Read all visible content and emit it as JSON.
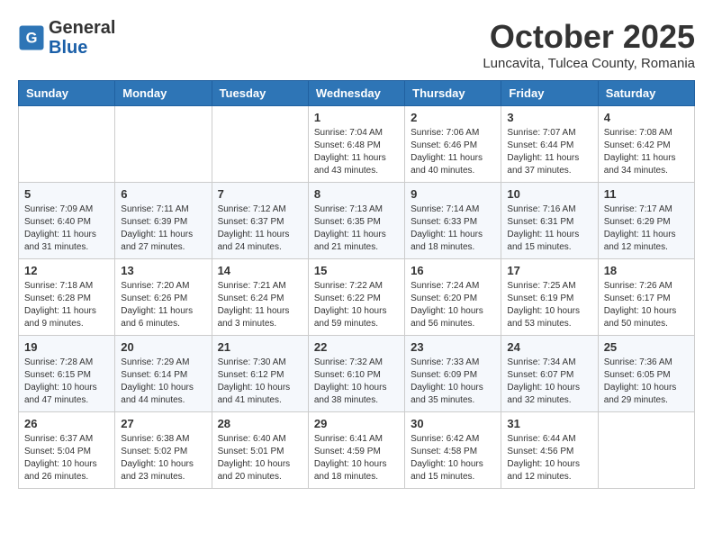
{
  "header": {
    "logo": {
      "general": "General",
      "blue": "Blue"
    },
    "title": "October 2025",
    "subtitle": "Luncavita, Tulcea County, Romania"
  },
  "weekdays": [
    "Sunday",
    "Monday",
    "Tuesday",
    "Wednesday",
    "Thursday",
    "Friday",
    "Saturday"
  ],
  "weeks": [
    [
      {
        "day": "",
        "info": ""
      },
      {
        "day": "",
        "info": ""
      },
      {
        "day": "",
        "info": ""
      },
      {
        "day": "1",
        "info": "Sunrise: 7:04 AM\nSunset: 6:48 PM\nDaylight: 11 hours\nand 43 minutes."
      },
      {
        "day": "2",
        "info": "Sunrise: 7:06 AM\nSunset: 6:46 PM\nDaylight: 11 hours\nand 40 minutes."
      },
      {
        "day": "3",
        "info": "Sunrise: 7:07 AM\nSunset: 6:44 PM\nDaylight: 11 hours\nand 37 minutes."
      },
      {
        "day": "4",
        "info": "Sunrise: 7:08 AM\nSunset: 6:42 PM\nDaylight: 11 hours\nand 34 minutes."
      }
    ],
    [
      {
        "day": "5",
        "info": "Sunrise: 7:09 AM\nSunset: 6:40 PM\nDaylight: 11 hours\nand 31 minutes."
      },
      {
        "day": "6",
        "info": "Sunrise: 7:11 AM\nSunset: 6:39 PM\nDaylight: 11 hours\nand 27 minutes."
      },
      {
        "day": "7",
        "info": "Sunrise: 7:12 AM\nSunset: 6:37 PM\nDaylight: 11 hours\nand 24 minutes."
      },
      {
        "day": "8",
        "info": "Sunrise: 7:13 AM\nSunset: 6:35 PM\nDaylight: 11 hours\nand 21 minutes."
      },
      {
        "day": "9",
        "info": "Sunrise: 7:14 AM\nSunset: 6:33 PM\nDaylight: 11 hours\nand 18 minutes."
      },
      {
        "day": "10",
        "info": "Sunrise: 7:16 AM\nSunset: 6:31 PM\nDaylight: 11 hours\nand 15 minutes."
      },
      {
        "day": "11",
        "info": "Sunrise: 7:17 AM\nSunset: 6:29 PM\nDaylight: 11 hours\nand 12 minutes."
      }
    ],
    [
      {
        "day": "12",
        "info": "Sunrise: 7:18 AM\nSunset: 6:28 PM\nDaylight: 11 hours\nand 9 minutes."
      },
      {
        "day": "13",
        "info": "Sunrise: 7:20 AM\nSunset: 6:26 PM\nDaylight: 11 hours\nand 6 minutes."
      },
      {
        "day": "14",
        "info": "Sunrise: 7:21 AM\nSunset: 6:24 PM\nDaylight: 11 hours\nand 3 minutes."
      },
      {
        "day": "15",
        "info": "Sunrise: 7:22 AM\nSunset: 6:22 PM\nDaylight: 10 hours\nand 59 minutes."
      },
      {
        "day": "16",
        "info": "Sunrise: 7:24 AM\nSunset: 6:20 PM\nDaylight: 10 hours\nand 56 minutes."
      },
      {
        "day": "17",
        "info": "Sunrise: 7:25 AM\nSunset: 6:19 PM\nDaylight: 10 hours\nand 53 minutes."
      },
      {
        "day": "18",
        "info": "Sunrise: 7:26 AM\nSunset: 6:17 PM\nDaylight: 10 hours\nand 50 minutes."
      }
    ],
    [
      {
        "day": "19",
        "info": "Sunrise: 7:28 AM\nSunset: 6:15 PM\nDaylight: 10 hours\nand 47 minutes."
      },
      {
        "day": "20",
        "info": "Sunrise: 7:29 AM\nSunset: 6:14 PM\nDaylight: 10 hours\nand 44 minutes."
      },
      {
        "day": "21",
        "info": "Sunrise: 7:30 AM\nSunset: 6:12 PM\nDaylight: 10 hours\nand 41 minutes."
      },
      {
        "day": "22",
        "info": "Sunrise: 7:32 AM\nSunset: 6:10 PM\nDaylight: 10 hours\nand 38 minutes."
      },
      {
        "day": "23",
        "info": "Sunrise: 7:33 AM\nSunset: 6:09 PM\nDaylight: 10 hours\nand 35 minutes."
      },
      {
        "day": "24",
        "info": "Sunrise: 7:34 AM\nSunset: 6:07 PM\nDaylight: 10 hours\nand 32 minutes."
      },
      {
        "day": "25",
        "info": "Sunrise: 7:36 AM\nSunset: 6:05 PM\nDaylight: 10 hours\nand 29 minutes."
      }
    ],
    [
      {
        "day": "26",
        "info": "Sunrise: 6:37 AM\nSunset: 5:04 PM\nDaylight: 10 hours\nand 26 minutes."
      },
      {
        "day": "27",
        "info": "Sunrise: 6:38 AM\nSunset: 5:02 PM\nDaylight: 10 hours\nand 23 minutes."
      },
      {
        "day": "28",
        "info": "Sunrise: 6:40 AM\nSunset: 5:01 PM\nDaylight: 10 hours\nand 20 minutes."
      },
      {
        "day": "29",
        "info": "Sunrise: 6:41 AM\nSunset: 4:59 PM\nDaylight: 10 hours\nand 18 minutes."
      },
      {
        "day": "30",
        "info": "Sunrise: 6:42 AM\nSunset: 4:58 PM\nDaylight: 10 hours\nand 15 minutes."
      },
      {
        "day": "31",
        "info": "Sunrise: 6:44 AM\nSunset: 4:56 PM\nDaylight: 10 hours\nand 12 minutes."
      },
      {
        "day": "",
        "info": ""
      }
    ]
  ]
}
